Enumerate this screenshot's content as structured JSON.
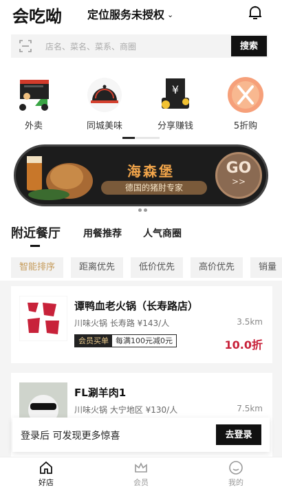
{
  "header": {
    "logo": "会吃呦",
    "location": "定位服务未授权"
  },
  "search": {
    "placeholder": "店名、菜名、菜系、商圈",
    "button": "搜索"
  },
  "categories": [
    {
      "label": "外卖",
      "icon": "delivery-scooter-icon"
    },
    {
      "label": "同城美味",
      "icon": "food-cloche-icon"
    },
    {
      "label": "分享赚钱",
      "icon": "share-earn-icon"
    },
    {
      "label": "5折购",
      "icon": "fork-knife-icon"
    }
  ],
  "banner": {
    "title": "海森堡",
    "subtitle": "德国的猪肘专家",
    "go": "GO",
    "go_arrows": ">>"
  },
  "tabs": [
    "附近餐厅",
    "用餐推荐",
    "人气商圈"
  ],
  "filters": [
    "智能排序",
    "距离优先",
    "低价优先",
    "高价优先",
    "销量"
  ],
  "restaurants": [
    {
      "name": "谭鸭血老火锅（长寿路店）",
      "meta": "川味火锅 长寿路 ¥143/人",
      "distance": "3.5km",
      "badge_member": "会员买单",
      "badge_offer": "每满100元减0元",
      "discount": "10.0折"
    },
    {
      "name": "FL涮羊肉1",
      "meta": "川味火锅 大宁地区 ¥130/人",
      "distance": "7.5km"
    }
  ],
  "login_prompt": {
    "text": "登录后 可发现更多惊喜",
    "button": "去登录"
  },
  "bottom_nav": [
    {
      "label": "好店",
      "icon": "home-icon"
    },
    {
      "label": "会员",
      "icon": "crown-icon"
    },
    {
      "label": "我的",
      "icon": "smiley-icon"
    }
  ],
  "colors": {
    "accent_gold": "#c59b5a",
    "discount_red": "#c8223a",
    "dark": "#111111"
  }
}
